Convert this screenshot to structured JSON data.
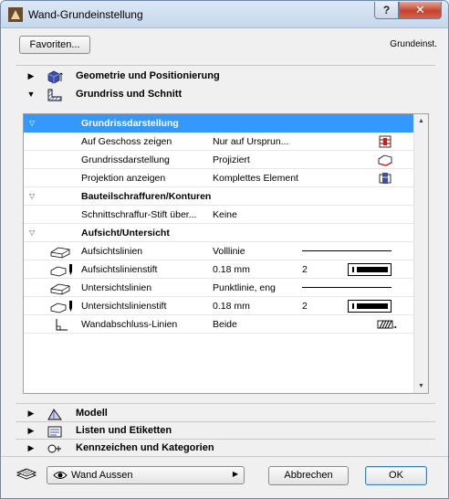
{
  "window": {
    "title": "Wand-Grundeinstellung",
    "help_label": "?",
    "close_label": "✕"
  },
  "toolbar": {
    "favorites_label": "Favoriten...",
    "preset_label": "Grundeinst."
  },
  "sections": {
    "geometry": {
      "label": "Geometrie und Positionierung",
      "icon": "geometry-icon"
    },
    "floorplan": {
      "label": "Grundriss und Schnitt",
      "icon": "floorplan-section-icon"
    },
    "model": {
      "label": "Modell",
      "icon": "model-icon"
    },
    "listings": {
      "label": "Listen und Etiketten",
      "icon": "listing-icon"
    },
    "categories": {
      "label": "Kennzeichen und Kategorien",
      "icon": "categories-icon"
    }
  },
  "panel": {
    "rows": [
      {
        "type": "group",
        "name": "Grundrissdarstellung",
        "selected": true
      },
      {
        "type": "prop",
        "name": "Auf Geschoss zeigen",
        "value": "Nur auf Ursprun...",
        "ricon": "story-icon"
      },
      {
        "type": "prop",
        "name": "Grundrissdarstellung",
        "value": "Projiziert",
        "ricon": "projected-icon"
      },
      {
        "type": "prop",
        "name": "Projektion anzeigen",
        "value": "Komplettes Element",
        "ricon": "projection-icon"
      },
      {
        "type": "group",
        "name": "Bauteilschraffuren/Konturen"
      },
      {
        "type": "prop",
        "name": "Schnittschraffur-Stift über...",
        "value": "Keine"
      },
      {
        "type": "group",
        "name": "Aufsicht/Untersicht"
      },
      {
        "type": "prop",
        "name": "Aufsichtslinien",
        "value": "Volllinie",
        "icon": "outline-icon",
        "line": true
      },
      {
        "type": "prop",
        "name": "Aufsichtslinienstift",
        "value": "0.18 mm",
        "num": "2",
        "icon": "pen-icon",
        "pen": true
      },
      {
        "type": "prop",
        "name": "Untersichtslinien",
        "value": "Punktlinie, eng",
        "icon": "outline-icon",
        "line": true
      },
      {
        "type": "prop",
        "name": "Untersichtslinienstift",
        "value": "0.18 mm",
        "num": "2",
        "icon": "pen-icon",
        "pen": true
      },
      {
        "type": "prop",
        "name": "Wandabschluss-Linien",
        "value": "Beide",
        "icon": "wall-end-icon",
        "ricon": "hatch-icon"
      }
    ]
  },
  "bottom": {
    "layer_dropdown": "Wand Aussen",
    "cancel_label": "Abbrechen",
    "ok_label": "OK"
  }
}
